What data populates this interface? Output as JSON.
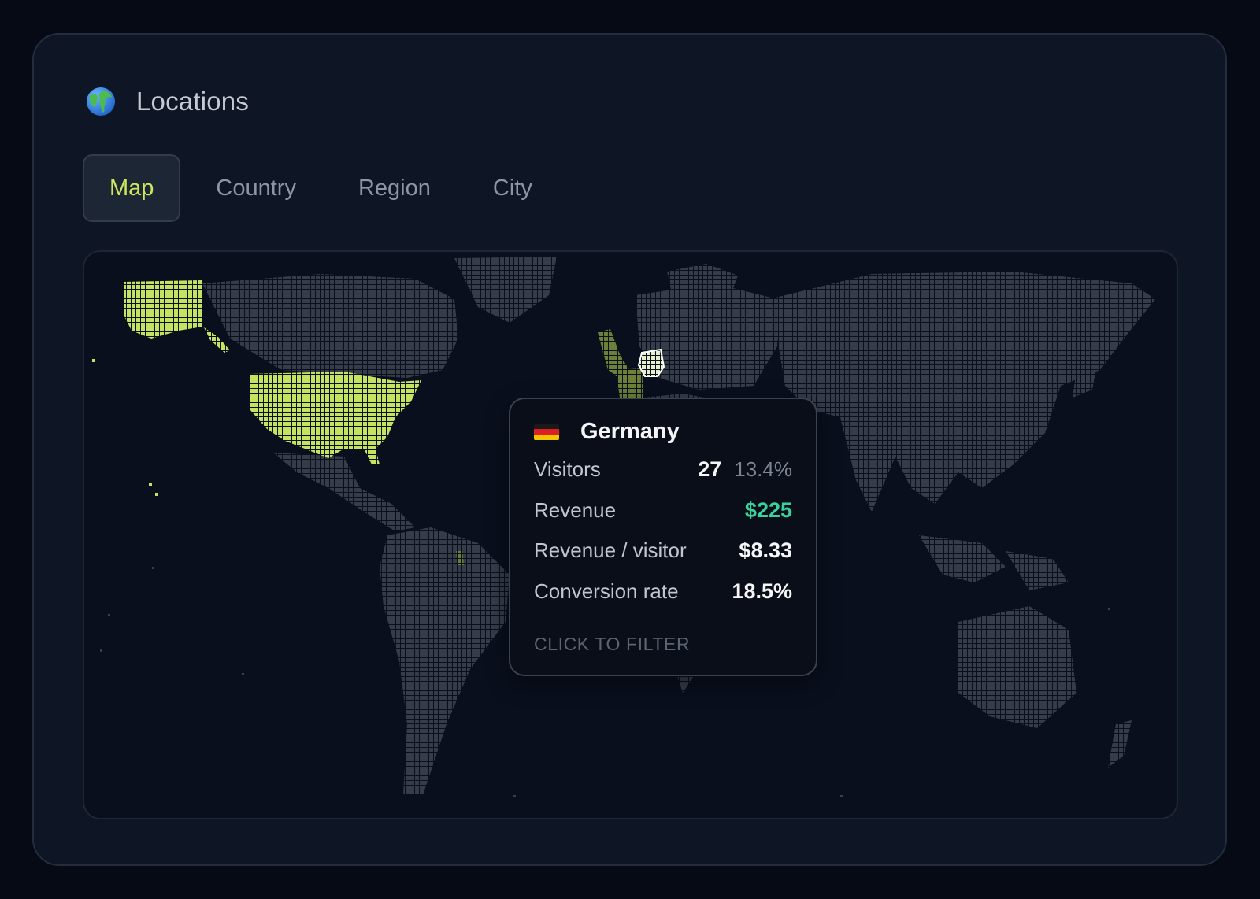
{
  "panel": {
    "title": "Locations",
    "icon": "globe-icon"
  },
  "tabs": [
    {
      "label": "Map",
      "active": true
    },
    {
      "label": "Country",
      "active": false
    },
    {
      "label": "Region",
      "active": false
    },
    {
      "label": "City",
      "active": false
    }
  ],
  "colors": {
    "accent": "#cde55f",
    "land": "#3a414d",
    "highlight": "#c4e35e",
    "highlight_dim": "#6d8035",
    "revenue": "#36d39f"
  },
  "map": {
    "highlighted_countries": [
      "United States",
      "United Kingdom",
      "Ireland",
      "Germany",
      "Portugal",
      "Guyana"
    ],
    "hovered_country": "Germany"
  },
  "tooltip": {
    "country": "Germany",
    "flag": "germany-flag-icon",
    "visitors_label": "Visitors",
    "visitors_value": "27",
    "visitors_pct": "13.4%",
    "revenue_label": "Revenue",
    "revenue_value": "$225",
    "rpv_label": "Revenue / visitor",
    "rpv_value": "$8.33",
    "conversion_label": "Conversion rate",
    "conversion_value": "18.5%",
    "cta": "CLICK TO FILTER"
  }
}
